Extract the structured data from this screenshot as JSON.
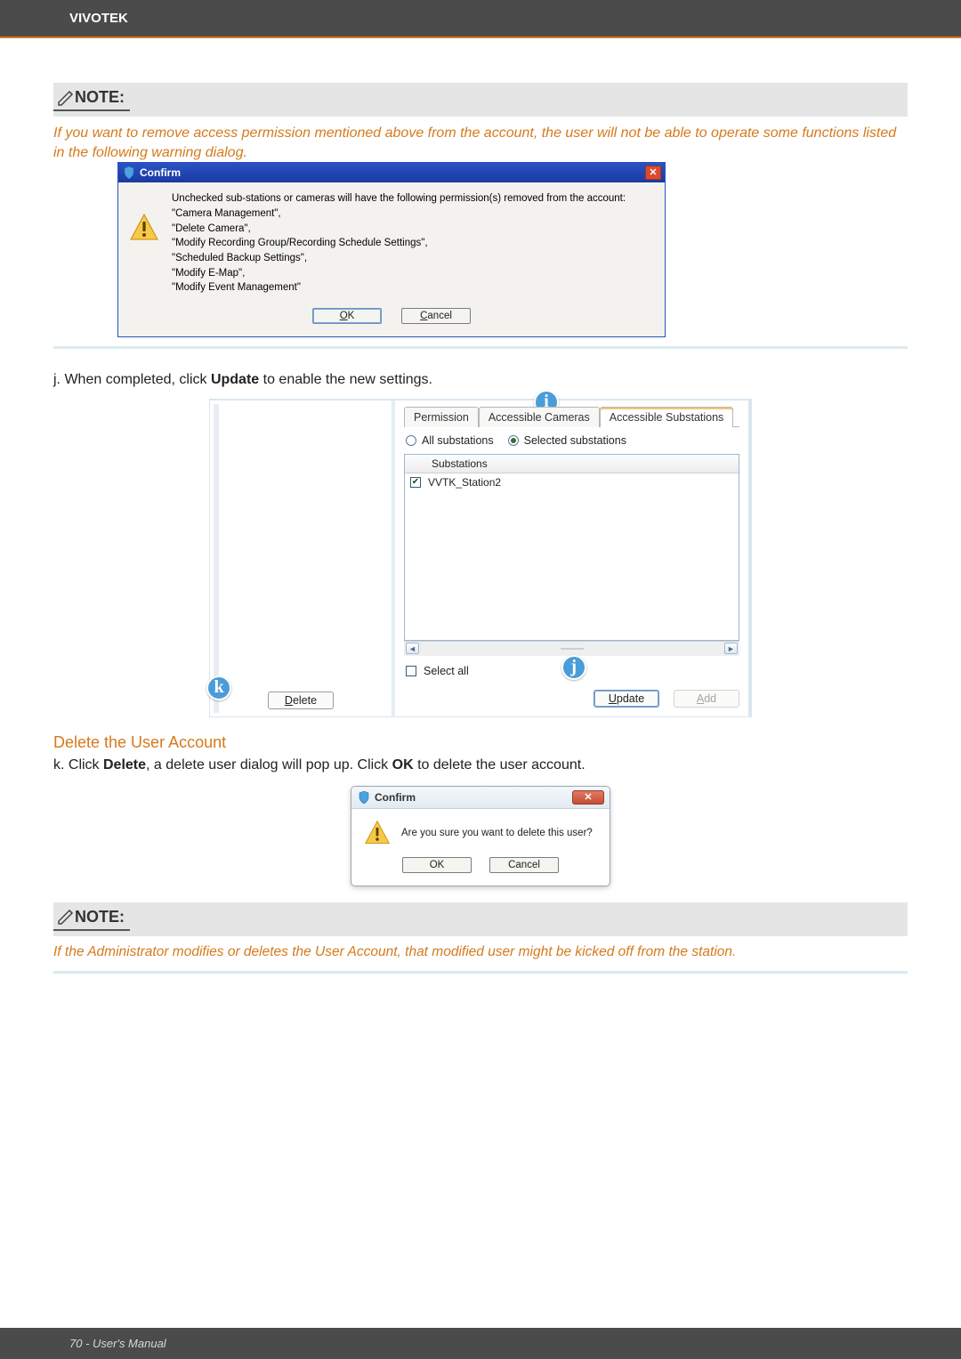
{
  "header": {
    "brand": "VIVOTEK"
  },
  "note1": {
    "label": "NOTE:",
    "text": "If you want to remove access permission mentioned above from the account, the user will not be able to operate some functions listed in the following warning dialog."
  },
  "dlg1": {
    "title": "Confirm",
    "line1": "Unchecked sub-stations or cameras will have the following permission(s) removed from the account:",
    "perm1": "\"Camera Management\",",
    "perm2": "\"Delete Camera\",",
    "perm3": "\"Modify Recording Group/Recording Schedule Settings\",",
    "perm4": "\"Scheduled Backup Settings\",",
    "perm5": "\"Modify E-Map\",",
    "perm6": "\"Modify Event Management\"",
    "ok_pre": "O",
    "ok_post": "K",
    "cancel_pre": "C",
    "cancel_post": "ancel"
  },
  "step_j": {
    "text_pre": "j. When completed, click ",
    "bold": "Update",
    "text_post": " to enable the new settings."
  },
  "panel": {
    "tab1": "Permission",
    "tab2": "Accessible Cameras",
    "tab3": "Accessible Substations",
    "radio_all": "All substations",
    "radio_sel": "Selected substations",
    "col": "Substations",
    "row1": "VVTK_Station2",
    "select_all": "Select all",
    "delete_pre": "D",
    "delete_post": "elete",
    "update_pre": "U",
    "update_post": "pdate",
    "add_pre": "A",
    "add_post": "dd",
    "callout_i": "i",
    "callout_j": "j",
    "callout_k": "k"
  },
  "section_delete": {
    "heading": "Delete the User Account"
  },
  "step_k": {
    "pre1": "k. Click ",
    "b1": "Delete",
    "mid": ", a delete user dialog will pop up. Click ",
    "b2": "OK",
    "post": " to delete the user account."
  },
  "dlg2": {
    "title": "Confirm",
    "msg": "Are you sure you want to delete this user?",
    "ok": "OK",
    "cancel": "Cancel"
  },
  "note2": {
    "label": "NOTE:",
    "text": "If the Administrator modifies or deletes the User Account, that modified user might be kicked off from the station."
  },
  "footer": {
    "text": "70 - User's Manual"
  }
}
